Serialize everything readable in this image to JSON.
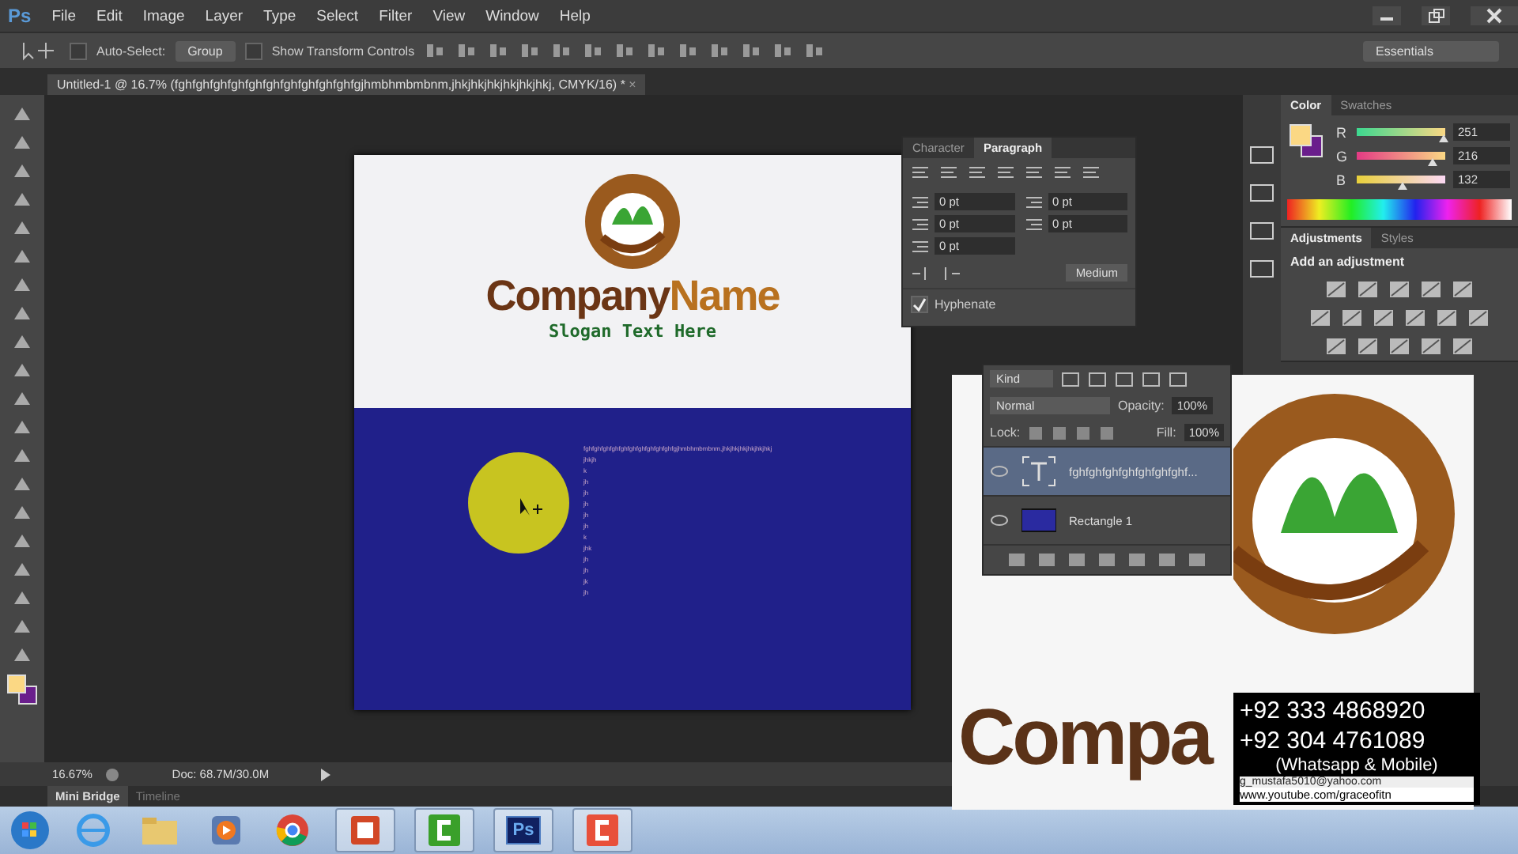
{
  "app_icon": "Ps",
  "menu": [
    "File",
    "Edit",
    "Image",
    "Layer",
    "Type",
    "Select",
    "Filter",
    "View",
    "Window",
    "Help"
  ],
  "options_bar": {
    "auto_select": {
      "label": "Auto-Select:",
      "checked": false
    },
    "auto_select_target": "Group",
    "transform_controls": {
      "label": "Show Transform Controls",
      "checked": false
    },
    "workspace": "Essentials"
  },
  "document_tab": {
    "title": "Untitled-1 @ 16.7% (fghfghfghfghfghfghfghfghfghfghfgjhmbhmbmbnm,jhkjhkjhkjhkjhkjhkj, CMYK/16) *",
    "close": "×"
  },
  "canvas": {
    "company_parts": [
      "Company",
      "Name"
    ],
    "slogan": "Slogan Text Here",
    "text_line": "fghfghfghfghfghfghfghfghfghfghfgjhmbhmbmbnm,jhkjhkjhkjhkjhkjhkj",
    "text_column": [
      "jhkjh",
      "k",
      "jh",
      "jh",
      "jh",
      "jh",
      "jh",
      "k",
      "jhk",
      "jh",
      "jh",
      "jk",
      "jh"
    ]
  },
  "paragraph_panel": {
    "tabs": [
      {
        "label": "Character",
        "selected": false
      },
      {
        "label": "Paragraph",
        "selected": true
      }
    ],
    "fields": [
      "0 pt",
      "0 pt",
      "0 pt",
      "0 pt",
      "0 pt"
    ],
    "composer": "Medium",
    "hyphenate": {
      "label": "Hyphenate",
      "checked": true
    }
  },
  "layers_panel": {
    "filter": "Kind",
    "blend_mode": "Normal",
    "opacity_label": "Opacity:",
    "opacity": "100%",
    "lock_label": "Lock:",
    "fill_label": "Fill:",
    "fill": "100%",
    "layers": [
      {
        "name": "fghfghfghfghfghfghfghf...",
        "kind": "text",
        "selected": true
      },
      {
        "name": "Rectangle 1",
        "kind": "shape",
        "selected": false
      }
    ]
  },
  "color_panel": {
    "tabs": [
      {
        "label": "Color",
        "selected": true
      },
      {
        "label": "Swatches",
        "selected": false
      }
    ],
    "channels": [
      {
        "name": "R",
        "value": "251",
        "level": 0.98
      },
      {
        "name": "G",
        "value": "216",
        "level": 0.85
      },
      {
        "name": "B",
        "value": "132",
        "level": 0.52
      }
    ]
  },
  "adjustments_panel": {
    "tabs": [
      {
        "label": "Adjustments",
        "selected": true
      },
      {
        "label": "Styles",
        "selected": false
      }
    ],
    "heading": "Add an adjustment"
  },
  "preview": {
    "word": "Compa"
  },
  "contact_overlay": {
    "lines": [
      "+92 333 4868920",
      "+92 304 4761089",
      "(Whatsapp & Mobile)"
    ],
    "email": "g_mustafa5010@yahoo.com",
    "url": "www.youtube.com/graceofitn"
  },
  "status_bar": {
    "zoom": "16.67%",
    "doc": "Doc: 68.7M/30.0M"
  },
  "bottom_tabs": [
    {
      "label": "Mini Bridge",
      "selected": true
    },
    {
      "label": "Timeline",
      "selected": false
    }
  ],
  "taskbar": {
    "apps": [
      {
        "kind": "ie",
        "running": false
      },
      {
        "kind": "folder",
        "running": false
      },
      {
        "kind": "media",
        "running": false
      },
      {
        "kind": "chrome",
        "running": false
      },
      {
        "kind": "powerpoint",
        "running": true
      },
      {
        "kind": "green",
        "running": true
      },
      {
        "kind": "photoshop",
        "running": true,
        "label": "Ps"
      },
      {
        "kind": "red",
        "running": true
      }
    ]
  }
}
